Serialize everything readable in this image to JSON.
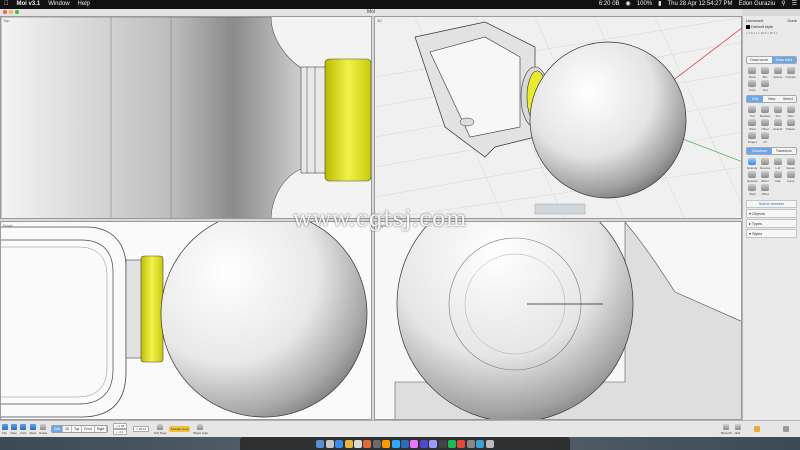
{
  "menubar": {
    "app": "Moi v3.1",
    "items": [
      "Window",
      "Help"
    ],
    "battery": "100%",
    "clock": "Thu 28 Apr  12:54:27 PM",
    "user": "Edon Guraziu",
    "wifi_time": "6:20 0B"
  },
  "window": {
    "title": "Moi"
  },
  "viewports": {
    "top_label": "Top",
    "perspective_label": "3D",
    "front_label": "Front",
    "right_label": "Right"
  },
  "panel": {
    "name": "Unnamed",
    "name_action": "Done",
    "layer": "Default style",
    "dims": "x 7.0 y 1 x 16.5 x 15.7 z",
    "draw_tabs": [
      "Draw curve",
      "Draw solid"
    ],
    "draw_tools": [
      "Plane",
      "Box",
      "Sphere",
      "Cylinder",
      "Cone",
      "Text"
    ],
    "edit_tabs": [
      "Edit",
      "View",
      "Select"
    ],
    "edit_tools": [
      "Trim",
      "Boolean",
      "Join",
      "Fillet",
      "Shell",
      "Offset",
      "Extend",
      "Pattern",
      "Project",
      "Fit"
    ],
    "construct_tabs": [
      "Construct",
      "Transform"
    ],
    "construct_tools": [
      "Extrude",
      "Revolve",
      "Loft",
      "Sweep",
      "Network",
      "Blend",
      "Rail",
      "Curve",
      "Shell",
      "Offset"
    ],
    "scene_browser": "Scene browser",
    "sections": [
      "Objects",
      "Types",
      "Styles"
    ]
  },
  "toolbar": {
    "file_buttons": [
      "File",
      "Save",
      "Undo",
      "Redo",
      "Delete"
    ],
    "view_modes": [
      "Split",
      "3D",
      "Top",
      "Front",
      "Right"
    ],
    "coord_x": "x 1.58",
    "coord_y": "y -0.1",
    "coord_z": "z 28.12",
    "grid_label": "Grid Snap",
    "straight_label": "Straight snap",
    "object_label": "Object snap",
    "show_label": "Show All",
    "hide_label": "Hide"
  },
  "watermark": "www.cgtsj.com",
  "colors": {
    "accent": "#6aa6e8",
    "highlight_yellow": "#e8ea2e",
    "menubar": "#111111"
  }
}
